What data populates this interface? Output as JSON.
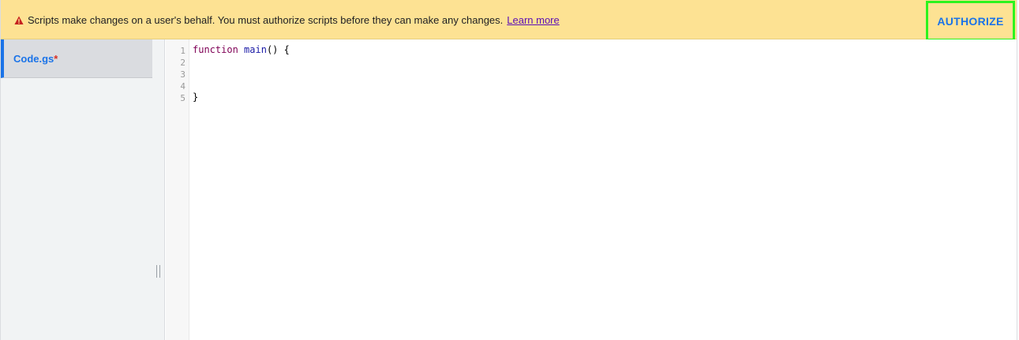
{
  "banner": {
    "icon": "warning-triangle-icon",
    "message": "Scripts make changes on a user's behalf. You must authorize scripts before they can make any changes.",
    "learn_more": "Learn more",
    "authorize_label": "AUTHORIZE"
  },
  "sidebar": {
    "files": [
      {
        "name": "Code.gs",
        "unsaved_marker": "*"
      }
    ]
  },
  "editor": {
    "line_numbers": [
      "1",
      "2",
      "3",
      "4",
      "5"
    ],
    "lines": [
      {
        "keyword": "function",
        "func_name": "main",
        "rest": "() {"
      },
      {
        "text": ""
      },
      {
        "text": ""
      },
      {
        "text": ""
      },
      {
        "text": "}"
      }
    ]
  },
  "colors": {
    "banner_bg": "#fde293",
    "accent_blue": "#1a73e8",
    "highlight_border": "#2df31d",
    "warning_red": "#d93025"
  }
}
